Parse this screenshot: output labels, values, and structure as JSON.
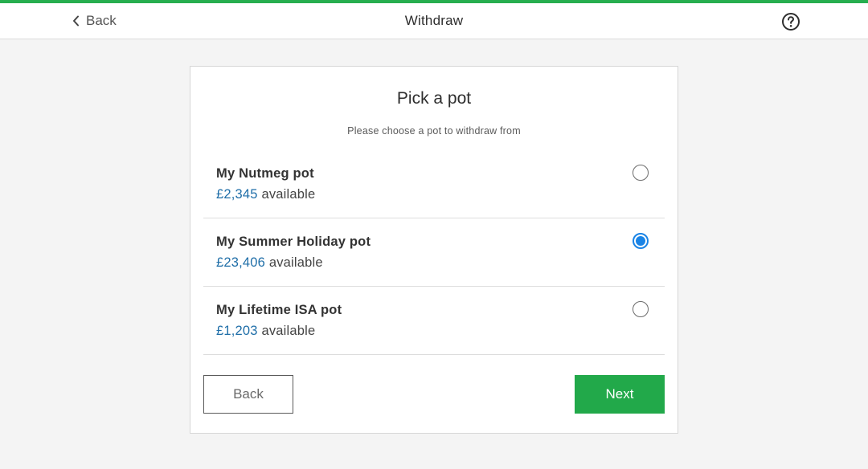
{
  "header": {
    "back_label": "Back",
    "title": "Withdraw",
    "help_icon": "question-circle-icon",
    "accent_color": "#27ae4f"
  },
  "card": {
    "title": "Pick a pot",
    "subtitle": "Please choose a pot to withdraw from",
    "pots": [
      {
        "name": "My Nutmeg pot",
        "amount": "£2,345",
        "suffix": "available",
        "selected": false
      },
      {
        "name": "My Summer Holiday pot",
        "amount": "£23,406",
        "suffix": "available",
        "selected": true
      },
      {
        "name": "My Lifetime ISA pot",
        "amount": "£1,203",
        "suffix": "available",
        "selected": false
      }
    ],
    "back_button": "Back",
    "next_button": "Next",
    "amount_color": "#1f6ea8",
    "selected_color": "#1a84e6",
    "next_color": "#22a94a"
  }
}
